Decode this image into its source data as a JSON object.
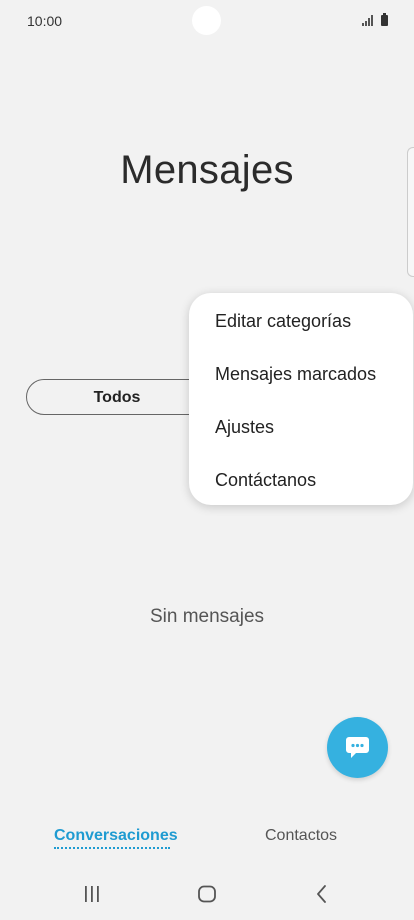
{
  "status_bar": {
    "time": "10:00"
  },
  "page": {
    "title": "Mensajes",
    "empty_text": "Sin mensajes"
  },
  "filter": {
    "selected_label": "Todos"
  },
  "menu": {
    "items": [
      {
        "label": "Editar categorías"
      },
      {
        "label": "Mensajes marcados"
      },
      {
        "label": "Ajustes"
      },
      {
        "label": "Contáctanos"
      }
    ]
  },
  "fab": {
    "icon": "chat-bubble-icon",
    "color": "#35b1e0"
  },
  "bottom_tabs": [
    {
      "label": "Conversaciones",
      "active": true
    },
    {
      "label": "Contactos",
      "active": false
    }
  ],
  "navbar": {
    "icons": [
      "recents-icon",
      "home-icon",
      "back-icon"
    ]
  },
  "colors": {
    "accent": "#1f9bd1",
    "background": "#f2f2f2"
  }
}
